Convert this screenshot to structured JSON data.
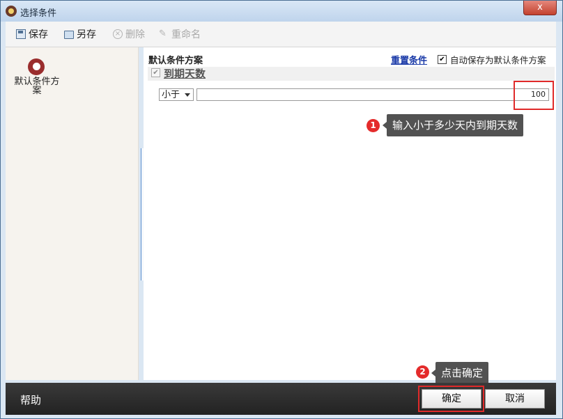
{
  "window": {
    "title": "选择条件",
    "close_label": "x"
  },
  "toolbar": {
    "items": [
      {
        "label": "保存",
        "icon": "save-icon",
        "enabled": true
      },
      {
        "label": "另存",
        "icon": "folder-icon",
        "enabled": true
      },
      {
        "label": "删除",
        "icon": "delete-icon",
        "enabled": false
      },
      {
        "label": "重命名",
        "icon": "rename-icon",
        "enabled": false
      }
    ]
  },
  "sidebar": {
    "scheme_label": "默认条件方案",
    "icon": "scheme-icon"
  },
  "panel": {
    "title": "默认条件方案",
    "reset_link": "重置条件",
    "autosave_label": "自动保存为默认条件方案",
    "autosave_checked": true
  },
  "condition": {
    "label": "到期天数",
    "checked": true,
    "operator": "小于",
    "value": "100"
  },
  "annotations": [
    {
      "number": "1",
      "text": "输入小于多少天内到期天数"
    },
    {
      "number": "2",
      "text": "点击确定"
    }
  ],
  "footer": {
    "help": "帮助",
    "ok": "确定",
    "cancel": "取消"
  },
  "colors": {
    "highlight": "#e02a2a",
    "badge": "#e42b2b",
    "callout_bg": "#525252",
    "footer_bg": "#2b2b2b"
  }
}
